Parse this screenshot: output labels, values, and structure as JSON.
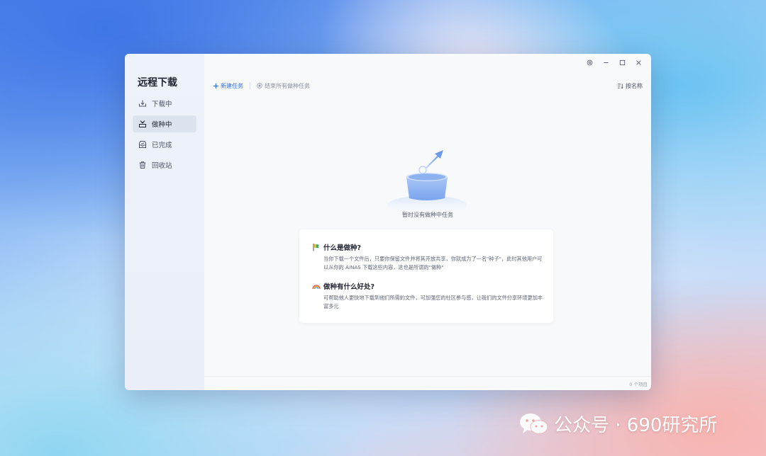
{
  "app": {
    "title": "远程下载"
  },
  "sidebar": {
    "items": [
      {
        "label": "下载中",
        "icon": "download-tray-icon"
      },
      {
        "label": "做种中",
        "icon": "seeding-icon",
        "active": true
      },
      {
        "label": "已完成",
        "icon": "completed-inbox-icon"
      },
      {
        "label": "回收站",
        "icon": "trash-icon"
      }
    ]
  },
  "toolbar": {
    "new_task": "新建任务",
    "stop_all": "结束所有做种任务",
    "sort": "按名称"
  },
  "empty": {
    "message": "暂时没有做种中任务"
  },
  "info_card": {
    "q1_title": "什么是做种?",
    "q1_body": "当你下载一个文件后，只要你保留文件并将其开放共享，你就成为了一名\"种子\"，此时其他用户可以从你的 AiNAS 下载这些内容，这也是所谓的\"做种\"",
    "q2_title": "做种有什么好处?",
    "q2_body": "可帮助他人更快地下载到他们所需的文件，可加强您的社区参与感，让我们的文件分享环境更加丰富多元"
  },
  "footer": {
    "count": "0 个项目"
  },
  "watermark": {
    "text": "公众号 · 690研究所"
  },
  "colors": {
    "accent": "#2f6fe4",
    "sidebar_bg": "#eef2fa",
    "active_item_bg": "#dde3ee"
  }
}
